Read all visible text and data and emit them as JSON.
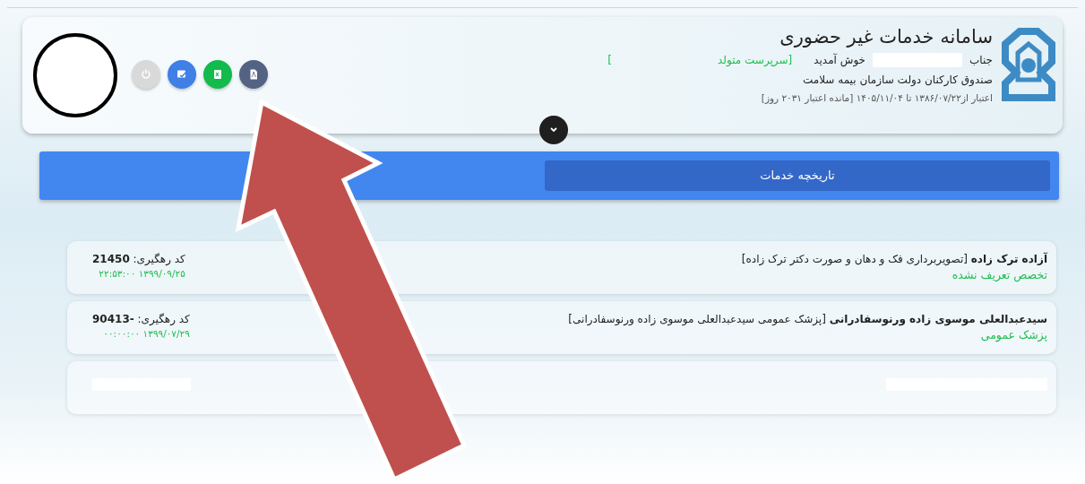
{
  "header": {
    "title": "سامانه خدمات غیر حضوری",
    "greeting": {
      "prefix": "جناب",
      "welcome": "خوش آمدید",
      "role_open": "[سرپرست متولد",
      "role_close": "]"
    },
    "organization": "صندوق کارکنان دولت سازمان بیمه سلامت",
    "validity": "اعتبار از۱۳۸۶/۰۷/۲۲ تا ۱۴۰۵/۱۱/۰۴ [مانده اعتبار ۲۰۳۱ روز]",
    "buttons": [
      {
        "kind": "power",
        "disabled": true
      },
      {
        "kind": "edit",
        "disabled": false
      },
      {
        "kind": "excel",
        "disabled": false
      },
      {
        "kind": "pdf",
        "disabled": false
      }
    ]
  },
  "history_button": "تاریخچه خدمات",
  "records": [
    {
      "title": "**آزاده ترک زاده** [تصویربرداری فک و دهان و صورت دکتر ترک زاده]",
      "specialty": "تخصص تعریف نشده",
      "tracking": "کد رهگیری: **21450**",
      "datetime": "۱۳۹۹/۰۹/۲۵ ۲۲:۵۳:۰۰"
    },
    {
      "title": "**سیدعبدالعلی موسوی زاده ورنوسفادرانی** [پزشک عمومی سیدعبدالعلی موسوی زاده ورنوسفادرانی]",
      "specialty": "پزشک عمومی",
      "tracking": "کد رهگیری: **-90413**",
      "datetime": "۱۳۹۹/۰۷/۲۹ ۰۰:۰۰:۰۰"
    }
  ]
}
